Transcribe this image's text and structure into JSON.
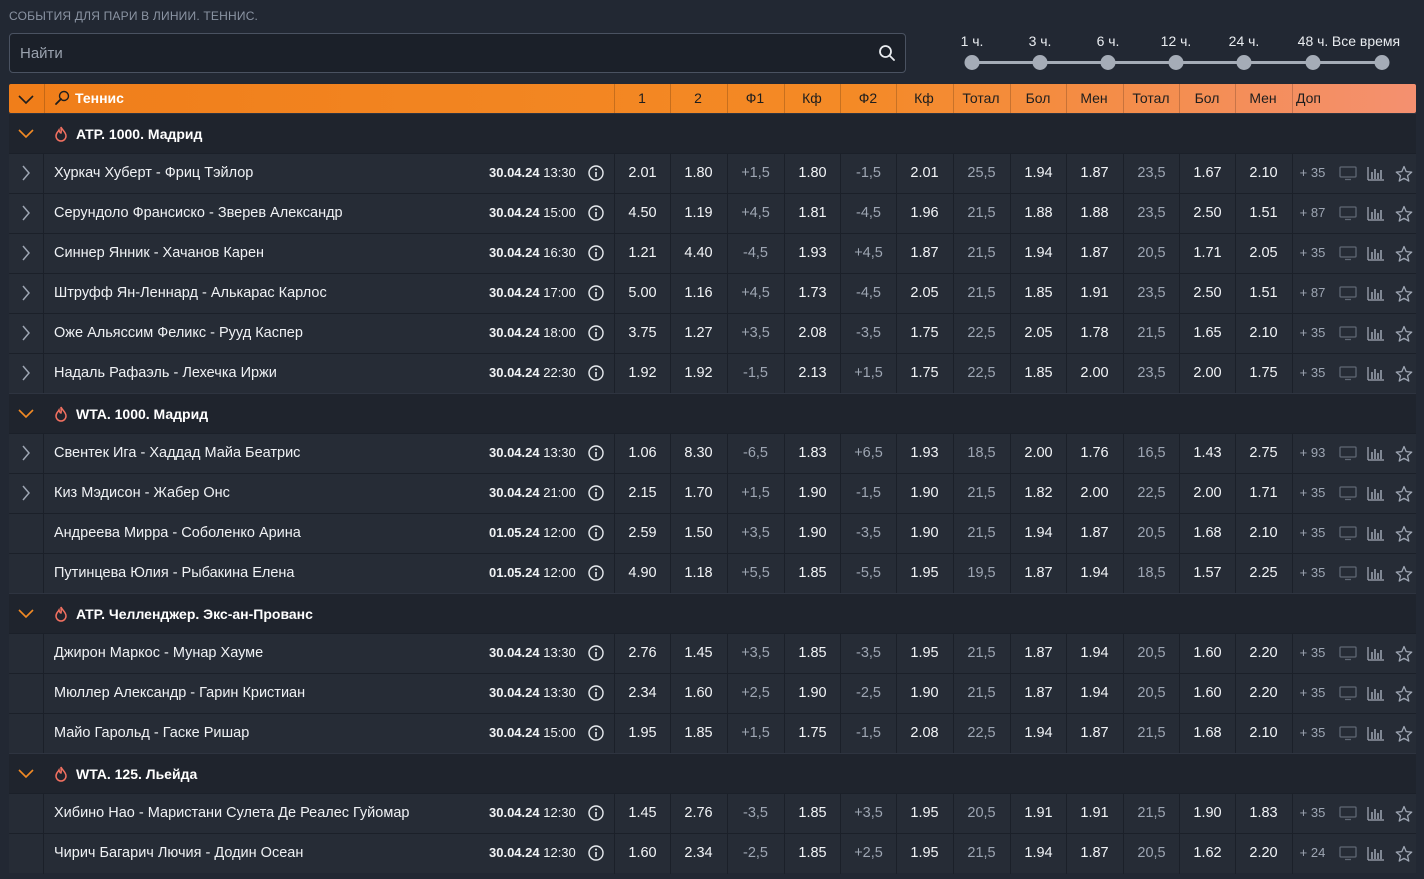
{
  "page_title": "СОБЫТИЯ ДЛЯ ПАРИ В ЛИНИИ. ТЕННИС.",
  "search": {
    "placeholder": "Найти"
  },
  "time_filter": {
    "options": [
      "1 ч.",
      "3 ч.",
      "6 ч.",
      "12 ч.",
      "24 ч.",
      "48 ч.",
      "Все время"
    ]
  },
  "header": {
    "sport": "Теннис",
    "columns": [
      "1",
      "2",
      "Ф1",
      "Кф",
      "Ф2",
      "Кф",
      "Тотал",
      "Бол",
      "Мен",
      "Тотал",
      "Бол",
      "Мен",
      "Доп"
    ]
  },
  "groups": [
    {
      "title": "ATP. 1000. Мадрид",
      "matches": [
        {
          "name": "Хуркач Хуберт - Фриц Тэйлор",
          "date": "30.04.24",
          "time": "13:30",
          "odds": [
            "2.01",
            "1.80",
            "+1,5",
            "1.80",
            "-1,5",
            "2.01",
            "25,5",
            "1.94",
            "1.87",
            "23,5",
            "1.67",
            "2.10"
          ],
          "extra": "+ 35",
          "expandable": true
        },
        {
          "name": "Серундоло Франсиско - Зверев Александр",
          "date": "30.04.24",
          "time": "15:00",
          "odds": [
            "4.50",
            "1.19",
            "+4,5",
            "1.81",
            "-4,5",
            "1.96",
            "21,5",
            "1.88",
            "1.88",
            "23,5",
            "2.50",
            "1.51"
          ],
          "extra": "+ 87",
          "expandable": true
        },
        {
          "name": "Синнер Янник - Хачанов Карен",
          "date": "30.04.24",
          "time": "16:30",
          "odds": [
            "1.21",
            "4.40",
            "-4,5",
            "1.93",
            "+4,5",
            "1.87",
            "21,5",
            "1.94",
            "1.87",
            "20,5",
            "1.71",
            "2.05"
          ],
          "extra": "+ 35",
          "expandable": true
        },
        {
          "name": "Штруфф Ян-Леннард - Алькарас Карлос",
          "date": "30.04.24",
          "time": "17:00",
          "odds": [
            "5.00",
            "1.16",
            "+4,5",
            "1.73",
            "-4,5",
            "2.05",
            "21,5",
            "1.85",
            "1.91",
            "23,5",
            "2.50",
            "1.51"
          ],
          "extra": "+ 87",
          "expandable": true
        },
        {
          "name": "Оже Альяссим Феликс - Рууд Каспер",
          "date": "30.04.24",
          "time": "18:00",
          "odds": [
            "3.75",
            "1.27",
            "+3,5",
            "2.08",
            "-3,5",
            "1.75",
            "22,5",
            "2.05",
            "1.78",
            "21,5",
            "1.65",
            "2.10"
          ],
          "extra": "+ 35",
          "expandable": true
        },
        {
          "name": "Надаль Рафаэль - Лехечка Иржи",
          "date": "30.04.24",
          "time": "22:30",
          "odds": [
            "1.92",
            "1.92",
            "-1,5",
            "2.13",
            "+1,5",
            "1.75",
            "22,5",
            "1.85",
            "2.00",
            "23,5",
            "2.00",
            "1.75"
          ],
          "extra": "+ 35",
          "expandable": true
        }
      ]
    },
    {
      "title": "WTA. 1000. Мадрид",
      "matches": [
        {
          "name": "Свентек Ига - Хаддад Майа Беатрис",
          "date": "30.04.24",
          "time": "13:30",
          "odds": [
            "1.06",
            "8.30",
            "-6,5",
            "1.83",
            "+6,5",
            "1.93",
            "18,5",
            "2.00",
            "1.76",
            "16,5",
            "1.43",
            "2.75"
          ],
          "extra": "+ 93",
          "expandable": true
        },
        {
          "name": "Киз Мэдисон - Жабер Онс",
          "date": "30.04.24",
          "time": "21:00",
          "odds": [
            "2.15",
            "1.70",
            "+1,5",
            "1.90",
            "-1,5",
            "1.90",
            "21,5",
            "1.82",
            "2.00",
            "22,5",
            "2.00",
            "1.71"
          ],
          "extra": "+ 35",
          "expandable": true
        },
        {
          "name": "Андреева Мирра - Соболенко Арина",
          "date": "01.05.24",
          "time": "12:00",
          "odds": [
            "2.59",
            "1.50",
            "+3,5",
            "1.90",
            "-3,5",
            "1.90",
            "21,5",
            "1.94",
            "1.87",
            "20,5",
            "1.68",
            "2.10"
          ],
          "extra": "+ 35",
          "expandable": false
        },
        {
          "name": "Путинцева Юлия - Рыбакина Елена",
          "date": "01.05.24",
          "time": "12:00",
          "odds": [
            "4.90",
            "1.18",
            "+5,5",
            "1.85",
            "-5,5",
            "1.95",
            "19,5",
            "1.87",
            "1.94",
            "18,5",
            "1.57",
            "2.25"
          ],
          "extra": "+ 35",
          "expandable": false
        }
      ]
    },
    {
      "title": "ATP. Челленджер. Экс-ан-Прованс",
      "matches": [
        {
          "name": "Джирон Маркос - Мунар Хауме",
          "date": "30.04.24",
          "time": "13:30",
          "odds": [
            "2.76",
            "1.45",
            "+3,5",
            "1.85",
            "-3,5",
            "1.95",
            "21,5",
            "1.87",
            "1.94",
            "20,5",
            "1.60",
            "2.20"
          ],
          "extra": "+ 35",
          "expandable": false
        },
        {
          "name": "Мюллер Александр - Гарин Кристиан",
          "date": "30.04.24",
          "time": "13:30",
          "odds": [
            "2.34",
            "1.60",
            "+2,5",
            "1.90",
            "-2,5",
            "1.90",
            "21,5",
            "1.87",
            "1.94",
            "20,5",
            "1.60",
            "2.20"
          ],
          "extra": "+ 35",
          "expandable": false
        },
        {
          "name": "Майо Гарольд - Гаске Ришар",
          "date": "30.04.24",
          "time": "15:00",
          "odds": [
            "1.95",
            "1.85",
            "+1,5",
            "1.75",
            "-1,5",
            "2.08",
            "22,5",
            "1.94",
            "1.87",
            "21,5",
            "1.68",
            "2.10"
          ],
          "extra": "+ 35",
          "expandable": false
        }
      ]
    },
    {
      "title": "WTA. 125. Льейда",
      "matches": [
        {
          "name": "Хибино Нао - Маристани Сулета Де Реалес Гуйомар",
          "date": "30.04.24",
          "time": "12:30",
          "odds": [
            "1.45",
            "2.76",
            "-3,5",
            "1.85",
            "+3,5",
            "1.95",
            "20,5",
            "1.91",
            "1.91",
            "21,5",
            "1.90",
            "1.83"
          ],
          "extra": "+ 35",
          "expandable": false
        },
        {
          "name": "Чирич Багарич Лючия - Додин Осеан",
          "date": "30.04.24",
          "time": "12:30",
          "odds": [
            "1.60",
            "2.34",
            "-2,5",
            "1.85",
            "+2,5",
            "1.95",
            "21,5",
            "1.94",
            "1.87",
            "20,5",
            "1.62",
            "2.20"
          ],
          "extra": "+ 24",
          "expandable": false
        }
      ]
    }
  ],
  "colors": {
    "accent": "#f07e1a",
    "background": "#222833",
    "row": "#262c36"
  },
  "icons": [
    "search-icon",
    "chevron-down-icon",
    "chevron-right-icon",
    "fire-icon",
    "info-icon",
    "tv-icon",
    "stats-icon",
    "star-icon",
    "racket-icon"
  ]
}
